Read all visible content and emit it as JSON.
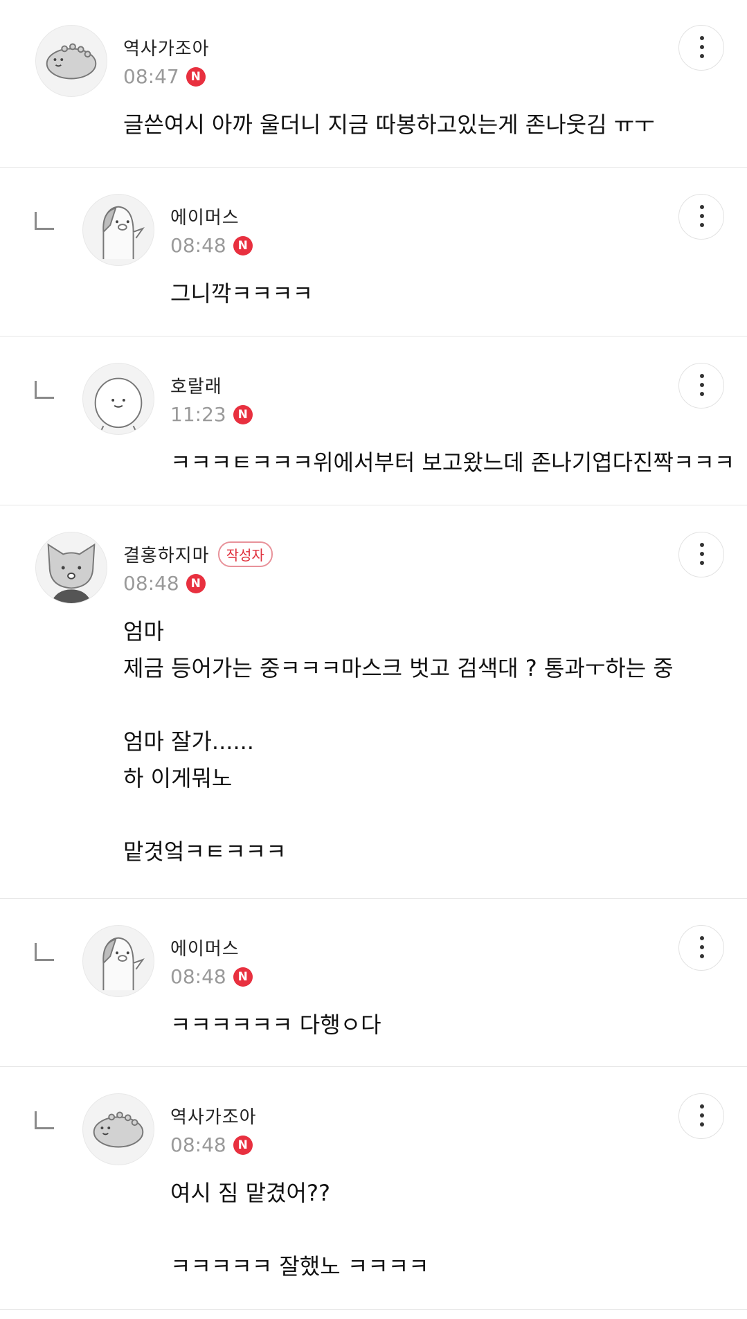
{
  "comments": [
    {
      "author": "역사가조아",
      "time": "08:47",
      "badge": "N",
      "is_reply": false,
      "avatar": "dinosaur-avatar",
      "text": "글쓴여시 아까 울더니 지금 따봉하고있는게 존나웃김 ㅠㅜ"
    },
    {
      "author": "에이머스",
      "time": "08:48",
      "badge": "N",
      "is_reply": true,
      "avatar": "penguin-avatar",
      "text": "그니깍ㅋㅋㅋㅋ"
    },
    {
      "author": "호랄래",
      "time": "11:23",
      "badge": "N",
      "is_reply": true,
      "avatar": "blob-avatar",
      "text": "ㅋㅋㅋㅌㅋㅋㅋ위에서부터 보고왔느데 존나기엽다진짝ㅋㅋㅋ"
    },
    {
      "author": "결홍하지마",
      "author_badge": "작성자",
      "time": "08:48",
      "badge": "N",
      "is_reply": false,
      "avatar": "cat-avatar",
      "text": "엄마\n제금 등어가는 중ㅋㅋㅋ마스크 벗고 검색대 ? 통과ㅜ하는 중\n\n엄마 잘가......\n하 이게뭐노\n\n맡겻엌ㅋㅌㅋㅋㅋ"
    },
    {
      "author": "에이머스",
      "time": "08:48",
      "badge": "N",
      "is_reply": true,
      "avatar": "penguin-avatar",
      "text": "ㅋㅋㅋㅋㅋㅋ 다행ㅇ다"
    },
    {
      "author": "역사가조아",
      "time": "08:48",
      "badge": "N",
      "is_reply": true,
      "avatar": "dinosaur-avatar",
      "text": "여시 짐 맡겼어??\n\nㅋㅋㅋㅋㅋ 잘했노 ㅋㅋㅋㅋ"
    }
  ]
}
